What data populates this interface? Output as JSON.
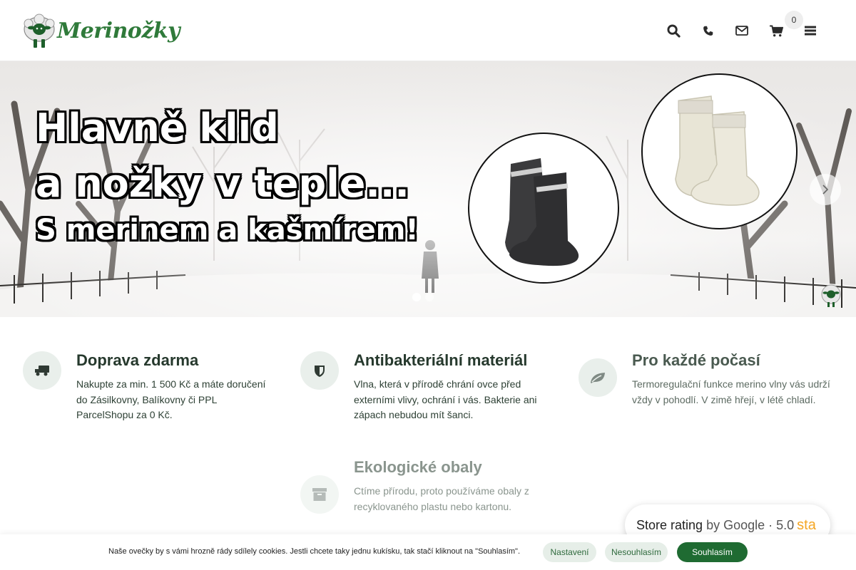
{
  "header": {
    "logo_text": "Merinožky",
    "cart_count": "0",
    "icons": [
      "search-icon",
      "phone-icon",
      "envelope-icon",
      "cart-icon",
      "menu-icon"
    ]
  },
  "hero": {
    "line1": "Hlavně klid",
    "line2": "a nožky v teple...",
    "line3": "S merinem a kašmírem!"
  },
  "features": [
    {
      "icon": "truck-icon",
      "title": "Doprava zdarma",
      "desc": "Nakupte za min. 1 500 Kč a máte doručení do Zásilkovny, Balíkovny či PPL ParcelShopu za 0 Kč."
    },
    {
      "icon": "shield-icon",
      "title": "Antibakteriální materiál",
      "desc": "Vlna, která v přírodě chrání ovce před externími vlivy, ochrání i vás. Bakterie ani zápach nebudou mít šanci."
    },
    {
      "icon": "leaf-icon",
      "title": "Pro každé počasí",
      "desc": "Termoregulační funkce merino vlny vás udrží vždy v pohodlí. V zimě hřejí, v létě chladí."
    },
    {
      "icon": "archive-box-icon",
      "title": "Ekologické obaly",
      "desc": "Ctíme přírodu, proto používáme obaly z recyklovaného plastu nebo kartonu."
    }
  ],
  "rating": {
    "label": "Store rating",
    "by": "by Google",
    "separator": "·",
    "score": "5.0",
    "stars_fragment": "sta"
  },
  "cookie": {
    "text": "Naše ovečky by s vámi hrozně rády sdílely cookies. Jestli chcete taky jednu kukísku, tak stačí kliknout na \"Souhlasím\".",
    "settings_label": "Nastavení",
    "decline_label": "Nesouhlasím",
    "accept_label": "Souhlasím"
  },
  "colors": {
    "brand_green": "#2f7a3a",
    "accept_button": "#1f6b32",
    "icon_circle": "#e9efeb",
    "star": "#f5a623"
  }
}
